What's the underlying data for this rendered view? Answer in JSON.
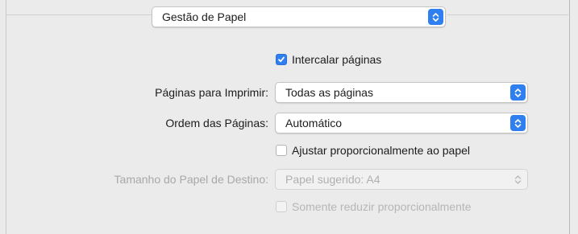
{
  "header": {
    "section_select": "Gestão de Papel"
  },
  "options": {
    "collate_label": "Intercalar páginas",
    "collate_checked": true,
    "pages_label": "Páginas para Imprimir:",
    "pages_value": "Todas as páginas",
    "order_label": "Ordem das Páginas:",
    "order_value": "Automático",
    "scale_label": "Ajustar proporcionalmente ao papel",
    "scale_checked": false,
    "dest_size_label": "Tamanho do Papel de Destino:",
    "dest_size_value": "Papel sugerido: A4",
    "scale_down_label": "Somente reduzir proporcionalmente",
    "scale_down_checked": false
  },
  "colors": {
    "accent": "#2f7ff0",
    "background": "#ebebeb",
    "disabled_text": "#a8a8a8"
  }
}
